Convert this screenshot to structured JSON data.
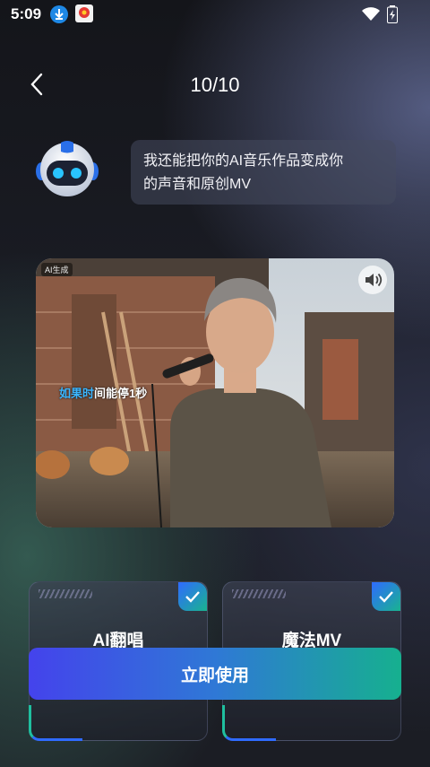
{
  "status_bar": {
    "time": "5:09",
    "icons": [
      "download-icon",
      "app-notification-icon",
      "wifi-icon",
      "battery-charging-icon"
    ]
  },
  "header": {
    "back_icon": "chevron-left-icon",
    "page_counter": "10/10"
  },
  "assistant": {
    "avatar_icon": "robot-icon",
    "message_line1": "我还能把你的AI音乐作品变成你",
    "message_line2": "的声音和原创MV"
  },
  "video": {
    "ai_badge": "AI生成",
    "sound_icon": "speaker-icon",
    "caption_highlight": "如果时",
    "caption_rest": "间能停1秒"
  },
  "features": [
    {
      "label": "AI翻唱",
      "selected": true
    },
    {
      "label": "魔法MV",
      "selected": true
    }
  ],
  "cta": {
    "label": "立即使用"
  },
  "colors": {
    "accent_blue": "#2f6bff",
    "accent_green": "#19b38f",
    "sky_blue_caption": "#3cb6ff"
  }
}
